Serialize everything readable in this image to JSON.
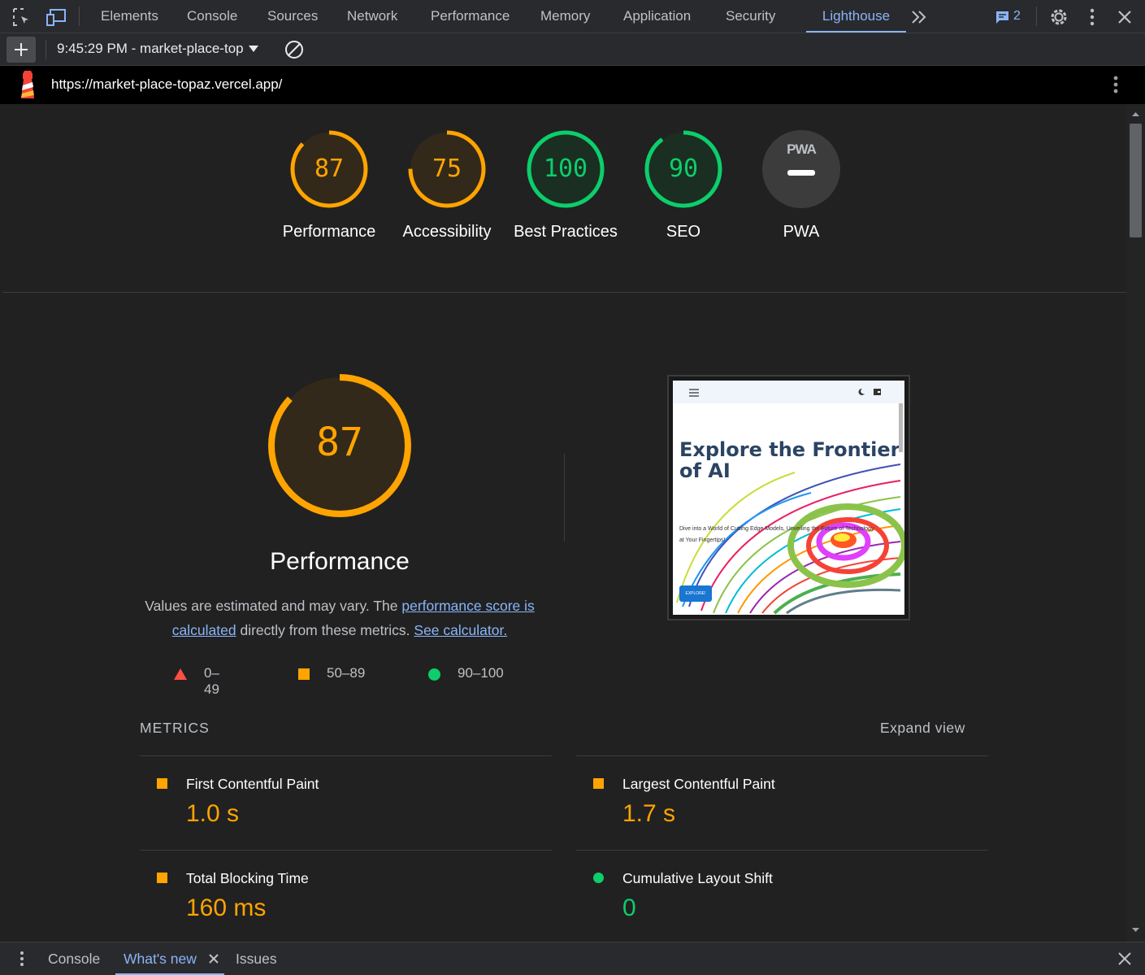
{
  "toolbar": {
    "tabs": [
      "Elements",
      "Console",
      "Sources",
      "Network",
      "Performance",
      "Memory",
      "Application",
      "Security",
      "Lighthouse"
    ],
    "active_tab": "Lighthouse",
    "issues_count": "2"
  },
  "subbar": {
    "report_label": "9:45:29 PM - market-place-top"
  },
  "urlbar": {
    "url": "https://market-place-topaz.vercel.app/"
  },
  "scores": {
    "performance": {
      "label": "Performance",
      "value": "87",
      "score": 87
    },
    "accessibility": {
      "label": "Accessibility",
      "value": "75",
      "score": 75
    },
    "best_practices": {
      "label": "Best Practices",
      "value": "100",
      "score": 100
    },
    "seo": {
      "label": "SEO",
      "value": "90",
      "score": 90
    },
    "pwa": {
      "label": "PWA",
      "badge": "PWA"
    }
  },
  "performance_section": {
    "score": "87",
    "score_value": 87,
    "title": "Performance",
    "desc_prefix": "Values are estimated and may vary. The ",
    "link_score": "performance score is calculated",
    "desc_middle": " directly from these metrics. ",
    "link_calculator": "See calculator.",
    "legend": [
      "0–49",
      "50–89",
      "90–100"
    ]
  },
  "metrics": {
    "title": "METRICS",
    "expand": "Expand view",
    "items": [
      {
        "name": "First Contentful Paint",
        "value": "1.0 s",
        "status": "average"
      },
      {
        "name": "Largest Contentful Paint",
        "value": "1.7 s",
        "status": "average"
      },
      {
        "name": "Total Blocking Time",
        "value": "160 ms",
        "status": "average"
      },
      {
        "name": "Cumulative Layout Shift",
        "value": "0",
        "status": "pass"
      }
    ]
  },
  "thumbnail": {
    "heading_line1": "Explore the Frontier",
    "heading_line2": "of AI",
    "subtext_line1": "Dive into a World of Cutting Edge Models, Unveiling the Future of Technology",
    "subtext_line2": "at Your Fingertips!",
    "button": "EXPLORE!"
  },
  "drawer": {
    "tabs": [
      "Console",
      "What's new",
      "Issues"
    ],
    "active_tab": "What's new"
  },
  "colors": {
    "average": "#ffa400",
    "pass": "#0cce6b",
    "fail": "#ff4e42",
    "accent": "#8ab4f8"
  }
}
